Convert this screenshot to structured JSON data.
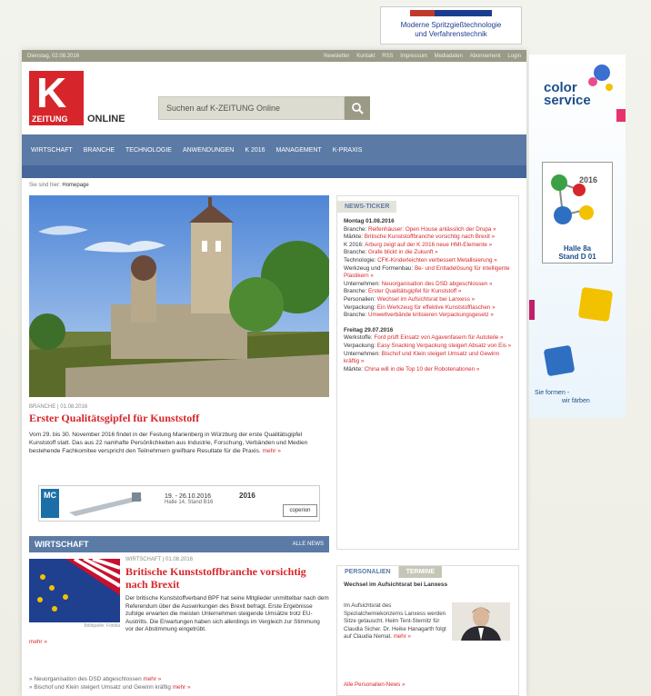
{
  "top_ad": {
    "line1": "Moderne Spritzgießtechnologie",
    "line2": "und Verfahrenstechnik"
  },
  "topbar": {
    "date": "Dienstag, 02.08.2016",
    "links": [
      "Newsletter",
      "Kontakt",
      "RSS",
      "Impressum",
      "Mediadaten",
      "Abonnement",
      "Login"
    ]
  },
  "brand": {
    "k": "K",
    "zeitung": "ZEITUNG",
    "online": "ONLINE",
    "accent": "#d7262b"
  },
  "search": {
    "placeholder": "Suchen auf K-ZEITUNG Online"
  },
  "nav": {
    "items": [
      "WIRTSCHAFT",
      "BRANCHE",
      "TECHNOLOGIE",
      "ANWENDUNGEN",
      "K 2016",
      "MANAGEMENT",
      "K-PRAXIS"
    ],
    "color": "#5b7aa6"
  },
  "breadcrumb": {
    "prefix": "Sie sind hier:",
    "current": "Homepage"
  },
  "lead": {
    "meta": "BRANCHE | 01.08.2016",
    "title": "Erster Qualitätsgipfel für Kunststoff",
    "text": "Vom 29. bis 30. November 2016 findet in der Festung Marienberg in Würzburg der erste Qualitätsgipfel Kunststoff statt. Das aus 22 namhafte Persönlichkeiten aus Industrie, Forschung, Verbänden und Medien bestehende Fachkomitee verspricht den Teilnehmern greifbare Resultate für die Praxis.",
    "more": "mehr »",
    "photo_credit": "KZ"
  },
  "banner": {
    "mc": "MC",
    "dates": "19. - 26.10.2016",
    "hall": "Halle 14, Stand B16",
    "badge": "2016",
    "brand": "coperion"
  },
  "section": {
    "title": "WIRTSCHAFT",
    "all": "ALLE NEWS"
  },
  "article2": {
    "meta": "WIRTSCHAFT | 01.08.2016",
    "title": "Britische Kunststoffbranche vorsichtig nach Brexit",
    "text": "Der britische Kunststoffverband BPF hat seine Mitglieder unmittelbar nach dem Referendum über die Auswirkungen des Brexit befragt. Erste Ergebnisse zufolge erwarten die meisten Unternehmen steigende Umsätze trotz EU-Austritts. Die Erwartungen haben sich allerdings im Vergleich zur Stimmung vor der Abstimmung eingetrübt.",
    "more": "mehr »",
    "photo_credit": "Bildquelle: Fotolia"
  },
  "bullets": [
    {
      "text": "» Neuorganisation des DSD abgeschlossen",
      "more": "mehr »"
    },
    {
      "text": "» Bischof und Klein steigert Umsatz und Gewinn kräftig",
      "more": "mehr »"
    }
  ],
  "ticker": {
    "tab": "NEWS-TICKER",
    "days": [
      {
        "date": "Montag 01.08.2016",
        "items": [
          {
            "cat": "Branche:",
            "text": "Reifenhäuser: Open House anlässlich der Drupa »"
          },
          {
            "cat": "Märkte:",
            "text": "Britische Kunststoffbranche vorsichtig nach Brexit »"
          },
          {
            "cat": "K 2016:",
            "text": "Arburg zeigt auf der K 2016 neue HMI-Elemente »"
          },
          {
            "cat": "Branche:",
            "text": "Grafe blickt in die Zukunft »"
          },
          {
            "cat": "Technologie:",
            "text": "CFK-Kinderleichten verbessert Metallisierung »"
          },
          {
            "cat": "Werkzeug und Formenbau:",
            "text": "Be- und Entladelösung für intelligente Plastikern »"
          },
          {
            "cat": "Unternehmen:",
            "text": "Neuorganisation des DSD abgeschlossen »"
          },
          {
            "cat": "Branche:",
            "text": "Erster Qualitätsgipfel für Kunststoff »"
          },
          {
            "cat": "Personalien:",
            "text": "Wechsel im Aufsichtsrat bei Lanxess »"
          },
          {
            "cat": "Verpackung:",
            "text": "Ein Werkzeug für effektive Kunststofflaschen »"
          },
          {
            "cat": "Branche:",
            "text": "Umweltverbände kritisieren Verpackungsgesetz »"
          }
        ]
      },
      {
        "date": "Freitag 29.07.2016",
        "items": [
          {
            "cat": "Werkstoffe:",
            "text": "Ford prüft Einsatz von Agavenfasern für Autoteile »"
          },
          {
            "cat": "Verpackung:",
            "text": "Easy Snacking Verpackung steigert Absatz von Eis »"
          },
          {
            "cat": "Unternehmen:",
            "text": "Bischof und Klein steigert Umsatz und Gewinn kräftig »"
          },
          {
            "cat": "Märkte:",
            "text": "China will in die Top 10 der Robotenationen »"
          }
        ]
      }
    ]
  },
  "personal": {
    "tab1": "PERSONALIEN",
    "tab2": "TERMINE",
    "headline": "Wechsel im Aufsichtsrat bei Lanxess",
    "text": "Im Aufsichtsrat des Spezialchemiekonzerns Lanxess werden Sitze getauscht. Heim Tent-Sternitz für Claudia Sicher. Dr. Heike Hanagarth folgt auf Claudia Nemat.",
    "more": "mehr »",
    "all": "Alle Personalien-News »"
  },
  "sky_ad": {
    "brand1": "color",
    "brand2": "service",
    "k2016": "2016",
    "hall": "Halle 8a",
    "stand": "Stand D 01",
    "slogan1": "Sie formen -",
    "slogan2": "wir färben"
  }
}
